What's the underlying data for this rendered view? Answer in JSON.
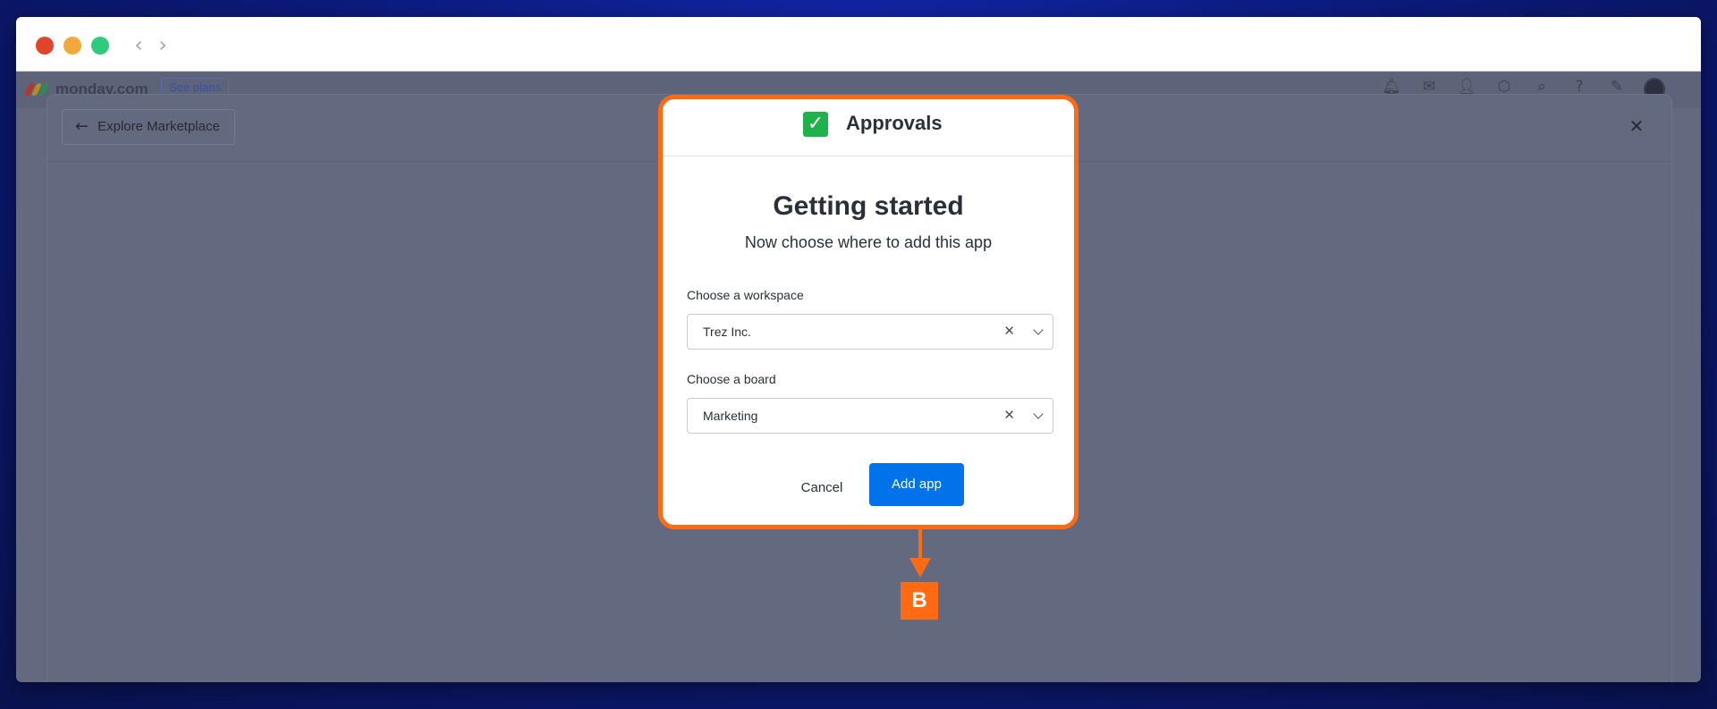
{
  "browser": {
    "back_glyph": "‹",
    "forward_glyph": "›"
  },
  "app_bar": {
    "logo_text": "monday.com",
    "see_plans": "See plans",
    "icons": [
      "bell-icon",
      "inbox-icon",
      "invite-icon",
      "apps-icon",
      "search-icon",
      "help-icon",
      "monday-icon",
      "avatar"
    ]
  },
  "sheet": {
    "back_label": "Explore Marketplace",
    "close_glyph": "✕"
  },
  "modal": {
    "app_name": "Approvals",
    "app_icon_glyph": "✓",
    "title": "Getting started",
    "subtitle": "Now choose where to add this app",
    "workspace": {
      "label": "Choose a workspace",
      "value": "Trez Inc.",
      "clear_glyph": "✕"
    },
    "board": {
      "label": "Choose a board",
      "value": "Marketing",
      "clear_glyph": "✕"
    },
    "cancel_label": "Cancel",
    "add_label": "Add app"
  },
  "annotation": {
    "label": "B"
  },
  "colors": {
    "accent_orange": "#ff6a13",
    "primary_blue": "#0073ea",
    "app_green": "#1fb14a"
  }
}
